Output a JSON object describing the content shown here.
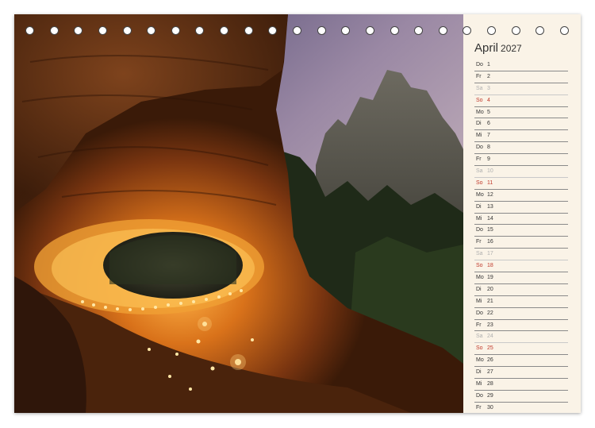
{
  "calendar": {
    "month": "April",
    "year": "2027",
    "days": [
      {
        "wd": "Do",
        "d": "1",
        "type": "weekday"
      },
      {
        "wd": "Fr",
        "d": "2",
        "type": "weekday"
      },
      {
        "wd": "Sa",
        "d": "3",
        "type": "sat"
      },
      {
        "wd": "So",
        "d": "4",
        "type": "sun"
      },
      {
        "wd": "Mo",
        "d": "5",
        "type": "weekday"
      },
      {
        "wd": "Di",
        "d": "6",
        "type": "weekday"
      },
      {
        "wd": "Mi",
        "d": "7",
        "type": "weekday"
      },
      {
        "wd": "Do",
        "d": "8",
        "type": "weekday"
      },
      {
        "wd": "Fr",
        "d": "9",
        "type": "weekday"
      },
      {
        "wd": "Sa",
        "d": "10",
        "type": "sat"
      },
      {
        "wd": "So",
        "d": "11",
        "type": "sun"
      },
      {
        "wd": "Mo",
        "d": "12",
        "type": "weekday"
      },
      {
        "wd": "Di",
        "d": "13",
        "type": "weekday"
      },
      {
        "wd": "Mi",
        "d": "14",
        "type": "weekday"
      },
      {
        "wd": "Do",
        "d": "15",
        "type": "weekday"
      },
      {
        "wd": "Fr",
        "d": "16",
        "type": "weekday"
      },
      {
        "wd": "Sa",
        "d": "17",
        "type": "sat"
      },
      {
        "wd": "So",
        "d": "18",
        "type": "sun"
      },
      {
        "wd": "Mo",
        "d": "19",
        "type": "weekday"
      },
      {
        "wd": "Di",
        "d": "20",
        "type": "weekday"
      },
      {
        "wd": "Mi",
        "d": "21",
        "type": "weekday"
      },
      {
        "wd": "Do",
        "d": "22",
        "type": "weekday"
      },
      {
        "wd": "Fr",
        "d": "23",
        "type": "weekday"
      },
      {
        "wd": "Sa",
        "d": "24",
        "type": "sat"
      },
      {
        "wd": "So",
        "d": "25",
        "type": "sun"
      },
      {
        "wd": "Mo",
        "d": "26",
        "type": "weekday"
      },
      {
        "wd": "Di",
        "d": "27",
        "type": "weekday"
      },
      {
        "wd": "Mi",
        "d": "28",
        "type": "weekday"
      },
      {
        "wd": "Do",
        "d": "29",
        "type": "weekday"
      },
      {
        "wd": "Fr",
        "d": "30",
        "type": "weekday"
      }
    ]
  },
  "colors": {
    "paper": "#faf3e7",
    "sunday": "#c0392b",
    "saturday": "#b0b0b0",
    "rule": "#8a8a8a"
  },
  "photo": {
    "icon": "landscape-photo-icon"
  },
  "binding": {
    "ring_count": 23,
    "icon": "spiral-ring-icon"
  }
}
